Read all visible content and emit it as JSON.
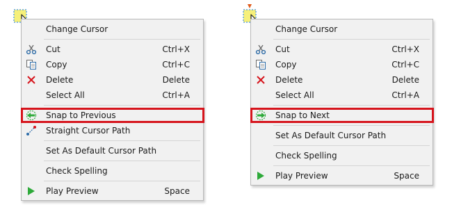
{
  "colors": {
    "menu_background": "#f1f1f1",
    "menu_border": "#b8b8b8",
    "highlight": "#d6141c",
    "accent_green": "#2eaa3a",
    "delete_red": "#d6141c",
    "cursor_marker": "#f6f07a"
  },
  "left_menu": {
    "items": [
      {
        "label": "Change Cursor",
        "shortcut": "",
        "icon": "none"
      },
      {
        "label": "Cut",
        "shortcut": "Ctrl+X",
        "icon": "scissors-icon"
      },
      {
        "label": "Copy",
        "shortcut": "Ctrl+C",
        "icon": "copy-icon"
      },
      {
        "label": "Delete",
        "shortcut": "Delete",
        "icon": "delete-x-icon"
      },
      {
        "label": "Select All",
        "shortcut": "Ctrl+A",
        "icon": "none"
      },
      {
        "label": "Snap to Previous",
        "shortcut": "",
        "icon": "snap-previous-icon",
        "highlighted": true
      },
      {
        "label": "Straight Cursor Path",
        "shortcut": "",
        "icon": "straight-path-icon"
      },
      {
        "label": "Set As Default Cursor Path",
        "shortcut": "",
        "icon": "none"
      },
      {
        "label": "Check Spelling",
        "shortcut": "",
        "icon": "none"
      },
      {
        "label": "Play Preview",
        "shortcut": "Space",
        "icon": "play-icon"
      }
    ]
  },
  "right_menu": {
    "items": [
      {
        "label": "Change Cursor",
        "shortcut": "",
        "icon": "none"
      },
      {
        "label": "Cut",
        "shortcut": "Ctrl+X",
        "icon": "scissors-icon"
      },
      {
        "label": "Copy",
        "shortcut": "Ctrl+C",
        "icon": "copy-icon"
      },
      {
        "label": "Delete",
        "shortcut": "Delete",
        "icon": "delete-x-icon"
      },
      {
        "label": "Select All",
        "shortcut": "Ctrl+A",
        "icon": "none"
      },
      {
        "label": "Snap to Next",
        "shortcut": "",
        "icon": "snap-next-icon",
        "highlighted": true
      },
      {
        "label": "Set As Default Cursor Path",
        "shortcut": "",
        "icon": "none"
      },
      {
        "label": "Check Spelling",
        "shortcut": "",
        "icon": "none"
      },
      {
        "label": "Play Preview",
        "shortcut": "Space",
        "icon": "play-icon"
      }
    ]
  }
}
